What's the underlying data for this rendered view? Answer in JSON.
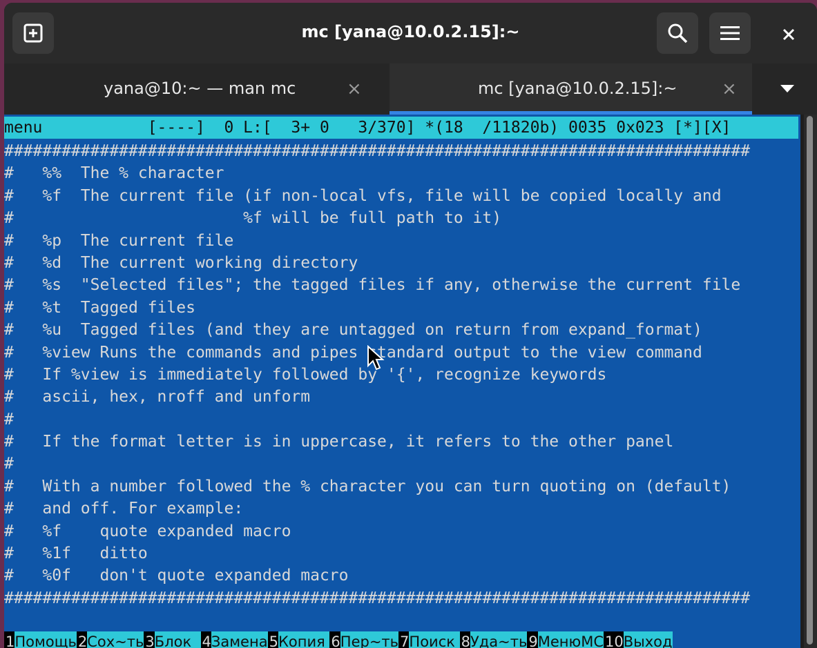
{
  "window": {
    "title": "mc [yana@10.0.2.15]:~",
    "close_glyph": "×"
  },
  "tabs": [
    {
      "label": "yana@10:~ — man mc",
      "close": "×",
      "active": false
    },
    {
      "label": "mc [yana@10.0.2.15]:~",
      "close": "×",
      "active": true
    }
  ],
  "editor": {
    "status_line": "menu           [----]  0 L:[  3+ 0   3/370] *(18  /11820b) 0035 0x023 [*][X]",
    "lines": [
      "##############################################################################",
      "#   %%  The % character",
      "#   %f  The current file (if non-local vfs, file will be copied locally and",
      "#                        %f will be full path to it)",
      "#   %p  The current file",
      "#   %d  The current working directory",
      "#   %s  \"Selected files\"; the tagged files if any, otherwise the current file",
      "#   %t  Tagged files",
      "#   %u  Tagged files (and they are untagged on return from expand_format)",
      "#   %view Runs the commands and pipes standard output to the view command",
      "#   If %view is immediately followed by '{', recognize keywords",
      "#   ascii, hex, nroff and unform",
      "#",
      "#   If the format letter is in uppercase, it refers to the other panel",
      "#",
      "#   With a number followed the % character you can turn quoting on (default)",
      "#   and off. For example:",
      "#   %f    quote expanded macro",
      "#   %1f   ditto",
      "#   %0f   don't quote expanded macro",
      "##############################################################################"
    ]
  },
  "function_keys": [
    {
      "num": "1",
      "label": "Помощь"
    },
    {
      "num": "2",
      "label": "Сох~ть"
    },
    {
      "num": "3",
      "label": "Блок  "
    },
    {
      "num": "4",
      "label": "Замена"
    },
    {
      "num": "5",
      "label": "Копия "
    },
    {
      "num": "6",
      "label": "Пер~ть"
    },
    {
      "num": "7",
      "label": "Поиск "
    },
    {
      "num": "8",
      "label": "Уда~ть"
    },
    {
      "num": "9",
      "label": "МенюMC"
    },
    {
      "num": "10",
      "label": "Выход"
    }
  ],
  "icons": {
    "new_tab": "new-tab-icon",
    "search": "search-icon",
    "menu": "hamburger-menu-icon",
    "tab_list": "chevron-down-icon",
    "pointer": "mouse-pointer-icon"
  },
  "colors": {
    "terminal_bg": "#0f56a8",
    "status_bar": "#2ec9d8",
    "accent": "#3584e4"
  }
}
